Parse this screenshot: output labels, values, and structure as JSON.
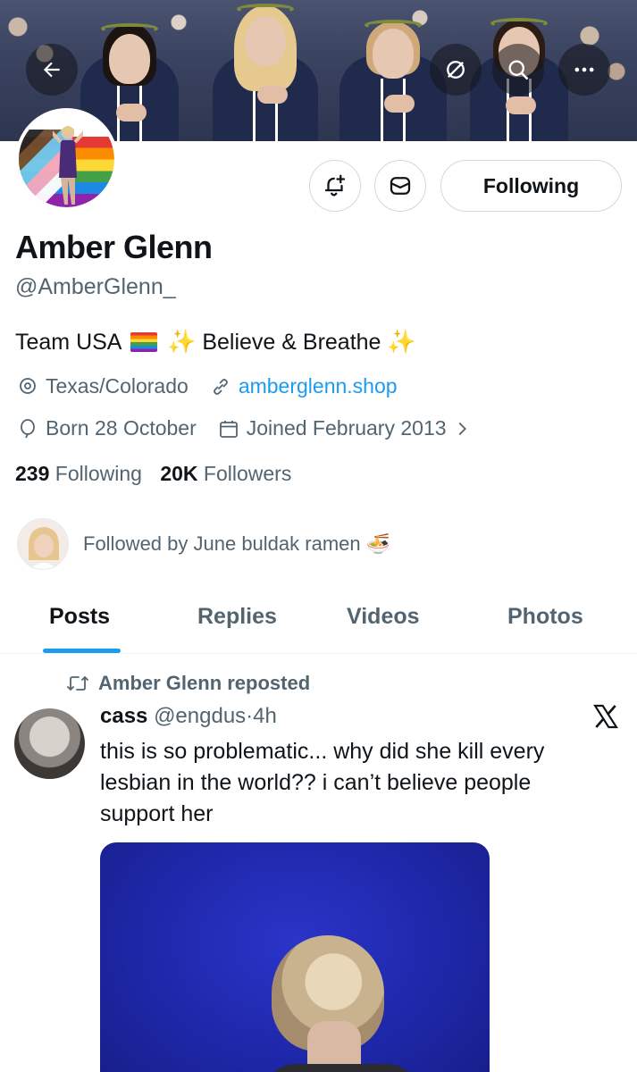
{
  "header": {
    "back_icon": "arrow-left-icon",
    "banner_actions": [
      "grok-icon",
      "search-icon",
      "more-icon"
    ]
  },
  "profile": {
    "name": "Amber Glenn",
    "handle": "@AmberGlenn_",
    "bio_part1": "Team USA",
    "bio_part2": "Believe & Breathe",
    "location": "Texas/Colorado",
    "website": "amberglenn.shop",
    "birthday": "Born 28 October",
    "joined": "Joined February 2013",
    "following_count": "239",
    "following_label": "Following",
    "followers_count": "20K",
    "followers_label": "Followers",
    "followed_by": "Followed by June buldak ramen",
    "follow_button_label": "Following"
  },
  "tabs": [
    {
      "label": "Posts",
      "active": true
    },
    {
      "label": "Replies",
      "active": false
    },
    {
      "label": "Videos",
      "active": false
    },
    {
      "label": "Photos",
      "active": false
    }
  ],
  "post": {
    "repost_label": "Amber Glenn reposted",
    "author_name": "cass",
    "author_handle": "@engdus",
    "separator": "·",
    "time": "4h",
    "text": "this is so problematic... why did she kill every lesbian in the world?? i can’t believe people support her"
  },
  "colors": {
    "accent": "#1d9bf0",
    "text_primary": "#0f1419",
    "text_secondary": "#536471",
    "border": "#cfd9de"
  }
}
